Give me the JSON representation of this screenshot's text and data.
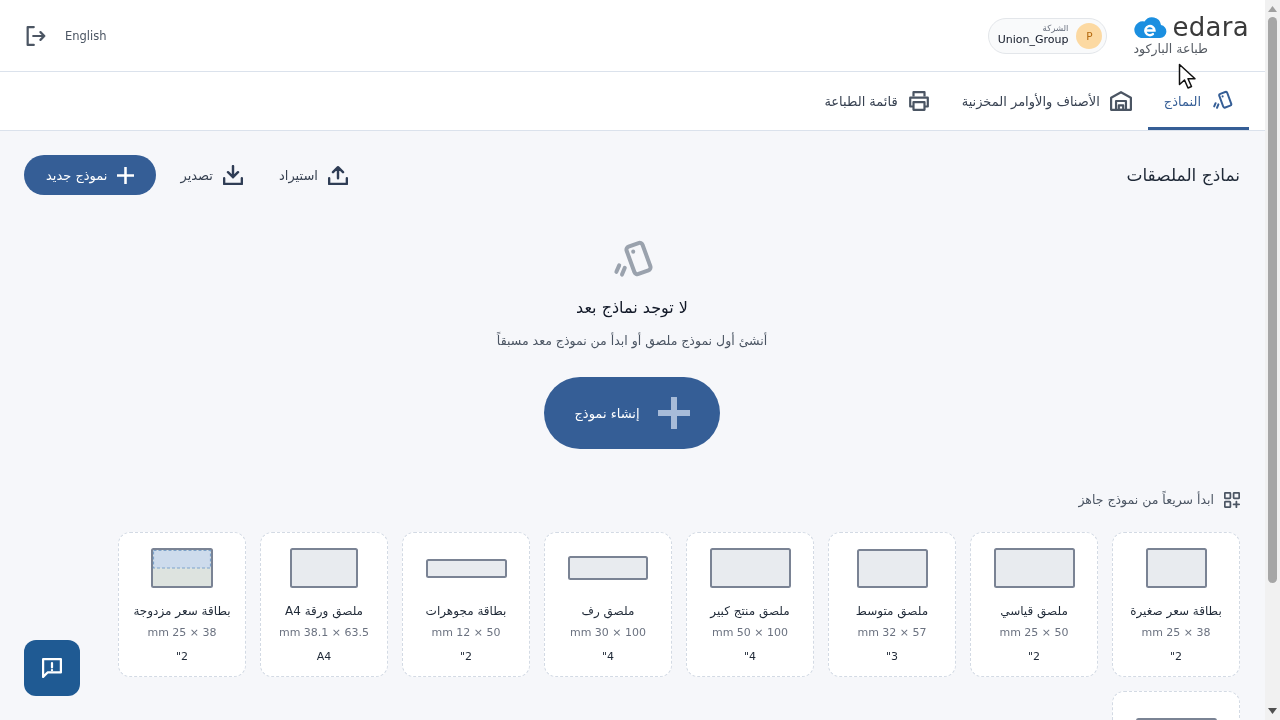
{
  "header": {
    "logo": {
      "wordmark": "edara",
      "subtitle": "طباعة الباركود"
    },
    "company": {
      "label": "الشركة",
      "name": "Union_Group",
      "initial": "P"
    },
    "language": "English"
  },
  "tabs": [
    {
      "label": "النماذج",
      "selected": true,
      "kind": "templates"
    },
    {
      "label": "الأصناف والأوامر المخزنية",
      "selected": false,
      "kind": "inventory"
    },
    {
      "label": "قائمة الطباعة",
      "selected": false,
      "kind": "print"
    }
  ],
  "toolbar": {
    "title": "نماذج الملصقات",
    "actions": [
      {
        "label": "استيراد",
        "kind": "import"
      },
      {
        "label": "تصدير",
        "kind": "export"
      },
      {
        "label": "نموذج جديد",
        "kind": "primary"
      }
    ]
  },
  "empty_state": {
    "title": "لا توجد نماذج بعد",
    "message": "أنشئ أول نموذج ملصق أو ابدأ من نموذج معد مسبقاً",
    "button": "إنشاء نموذج"
  },
  "quick_start": {
    "heading": "ابدأ سريعاً من نموذج جاهز",
    "templates": [
      {
        "name": "بطاقة سعر صغيرة",
        "dimensions": "38 × 25 mm",
        "size": "2\"",
        "kind": "small"
      },
      {
        "name": "ملصق قياسي",
        "dimensions": "50 × 25 mm",
        "size": "2\"",
        "kind": "wide"
      },
      {
        "name": "ملصق متوسط",
        "dimensions": "57 × 32 mm",
        "size": "3\"",
        "kind": "medium"
      },
      {
        "name": "ملصق منتج كبير",
        "dimensions": "100 × 50 mm",
        "size": "4\"",
        "kind": "wide"
      },
      {
        "name": "ملصق رف",
        "dimensions": "100 × 30 mm",
        "size": "4\"",
        "kind": "strip"
      },
      {
        "name": "بطاقة مجوهرات",
        "dimensions": "50 × 12 mm",
        "size": "2\"",
        "kind": "slim"
      },
      {
        "name": "ملصق ورقة A4",
        "dimensions": "63.5 × 38.1 mm",
        "size": "A4",
        "kind": "sheet"
      },
      {
        "name": "بطاقة سعر مزدوجة",
        "dimensions": "38 × 25 mm",
        "size": "2\"",
        "kind": "dual"
      },
      {
        "kind": "slim"
      }
    ]
  }
}
